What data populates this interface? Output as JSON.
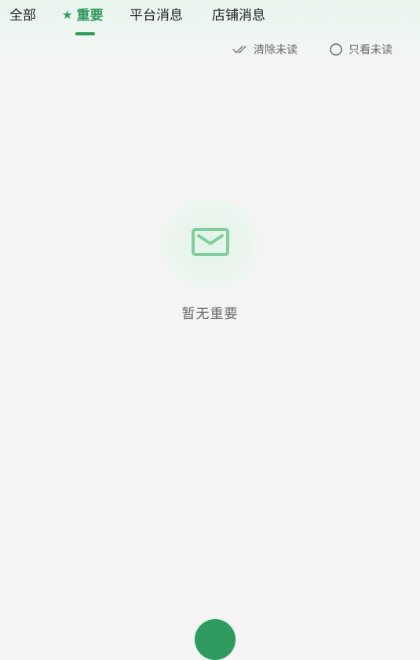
{
  "tabs": [
    {
      "label": "全部"
    },
    {
      "label": "重要",
      "icon": "star-icon",
      "active": true
    },
    {
      "label": "平台消息"
    },
    {
      "label": "店铺消息"
    }
  ],
  "actions": {
    "clear_unread": {
      "label": "清除未读",
      "icon": "double-check-icon"
    },
    "only_unread": {
      "label": "只看未读",
      "icon": "radio-circle-icon",
      "checked": false
    }
  },
  "empty_state": {
    "icon": "envelope-icon",
    "text": "暂无重要"
  },
  "colors": {
    "accent": "#2f9a5d",
    "empty_icon": "#7fcf9c",
    "empty_circle": "#e3f3e8",
    "background": "#f5f5f5"
  }
}
